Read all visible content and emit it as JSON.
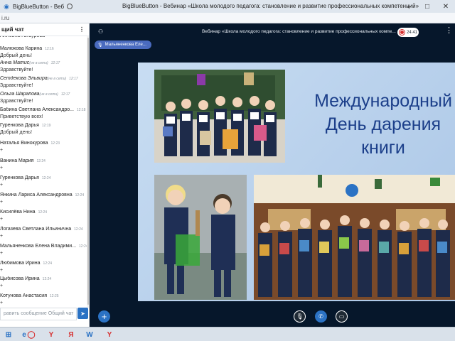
{
  "window": {
    "title": "BigBlueButton - Веб",
    "page_title": "BigBlueButton - Вебинар «Школа молодого педагога: становление и развитие профессиональных компетенций»",
    "controls": [
      "–",
      "□",
      "✕"
    ]
  },
  "urlbar": {
    "text": "i.ru"
  },
  "chat": {
    "header_title": "щий чат",
    "menu_icon": "⋮",
    "messages": [
      {
        "name": "Аллевна Гатаурова",
        "time": "",
        "text": "",
        "italic": false,
        "offline": ""
      },
      {
        "name": "Малюкова Карина",
        "time": "12:16",
        "text": "Добрый день!",
        "italic": false,
        "offline": ""
      },
      {
        "name": "Анна Матис",
        "time": "12:17",
        "text": "Здравствуйте!",
        "italic": true,
        "offline": "(не в сети)"
      },
      {
        "name": "Сетдекова Эльвира",
        "time": "12:17",
        "text": "Здравствуйте!",
        "italic": true,
        "offline": "(не в сети)"
      },
      {
        "name": "Ольга Шарапова",
        "time": "12:17",
        "text": "Здравствуйте!",
        "italic": true,
        "offline": "(не в сети)"
      },
      {
        "name": "Бабина Светлана Александро...",
        "time": "12:18",
        "text": "Приветствую всех!",
        "italic": false,
        "offline": ""
      },
      {
        "name": "Гуренкова Дарья",
        "time": "12:19",
        "text": "Добрый день!",
        "italic": false,
        "offline": ""
      },
      {
        "name": "Наталья Винокурова",
        "time": "12:23",
        "text": "+",
        "italic": false,
        "offline": ""
      },
      {
        "name": "Ванина Мария",
        "time": "12:24",
        "text": "+",
        "italic": false,
        "offline": ""
      },
      {
        "name": "Гуренкова Дарья",
        "time": "12:24",
        "text": "+",
        "italic": false,
        "offline": ""
      },
      {
        "name": "Янкина Лариса Александровна",
        "time": "12:24",
        "text": "+",
        "italic": false,
        "offline": ""
      },
      {
        "name": "Кисилёва Нина",
        "time": "12:24",
        "text": "+",
        "italic": false,
        "offline": ""
      },
      {
        "name": "Логазева Светлана Ильинична",
        "time": "12:24",
        "text": "+",
        "italic": false,
        "offline": ""
      },
      {
        "name": "Мальяненкова Елена Владими...",
        "time": "12:24",
        "text": "+",
        "italic": false,
        "offline": ""
      },
      {
        "name": "Любимова Ирина",
        "time": "12:24",
        "text": "+",
        "italic": false,
        "offline": ""
      },
      {
        "name": "Цыбисова Ирина",
        "time": "12:24",
        "text": "+",
        "italic": false,
        "offline": ""
      },
      {
        "name": "Котунова Анастасия",
        "time": "12:25",
        "text": "+",
        "italic": false,
        "offline": ""
      }
    ],
    "input_placeholder": "равить сообщение Общий чат",
    "send_icon": "➤"
  },
  "meeting": {
    "title": "Вебинар «Школа молодого педагога: становление и развитие профессиональных компе...",
    "recording_time": "24:41",
    "presenter_name": "Мальяненкова Еле...",
    "more_icon": "⋮"
  },
  "slide": {
    "title_lines": [
      "Международный",
      "День дарения",
      "книги"
    ],
    "title_color": "#1c3f8a"
  },
  "controls": {
    "plus_label": "+",
    "mute_icon": "🎙",
    "phone_icon": "✆",
    "screen_icon": "▭"
  },
  "taskbar": {
    "items": [
      "⊞",
      "e",
      "◯",
      "Y",
      "Я",
      "W",
      "Y"
    ]
  },
  "colors": {
    "accent": "#2b72c4",
    "recording": "#d63030",
    "main_bg": "#06172b",
    "slide_bg": "#c2d8ef"
  }
}
